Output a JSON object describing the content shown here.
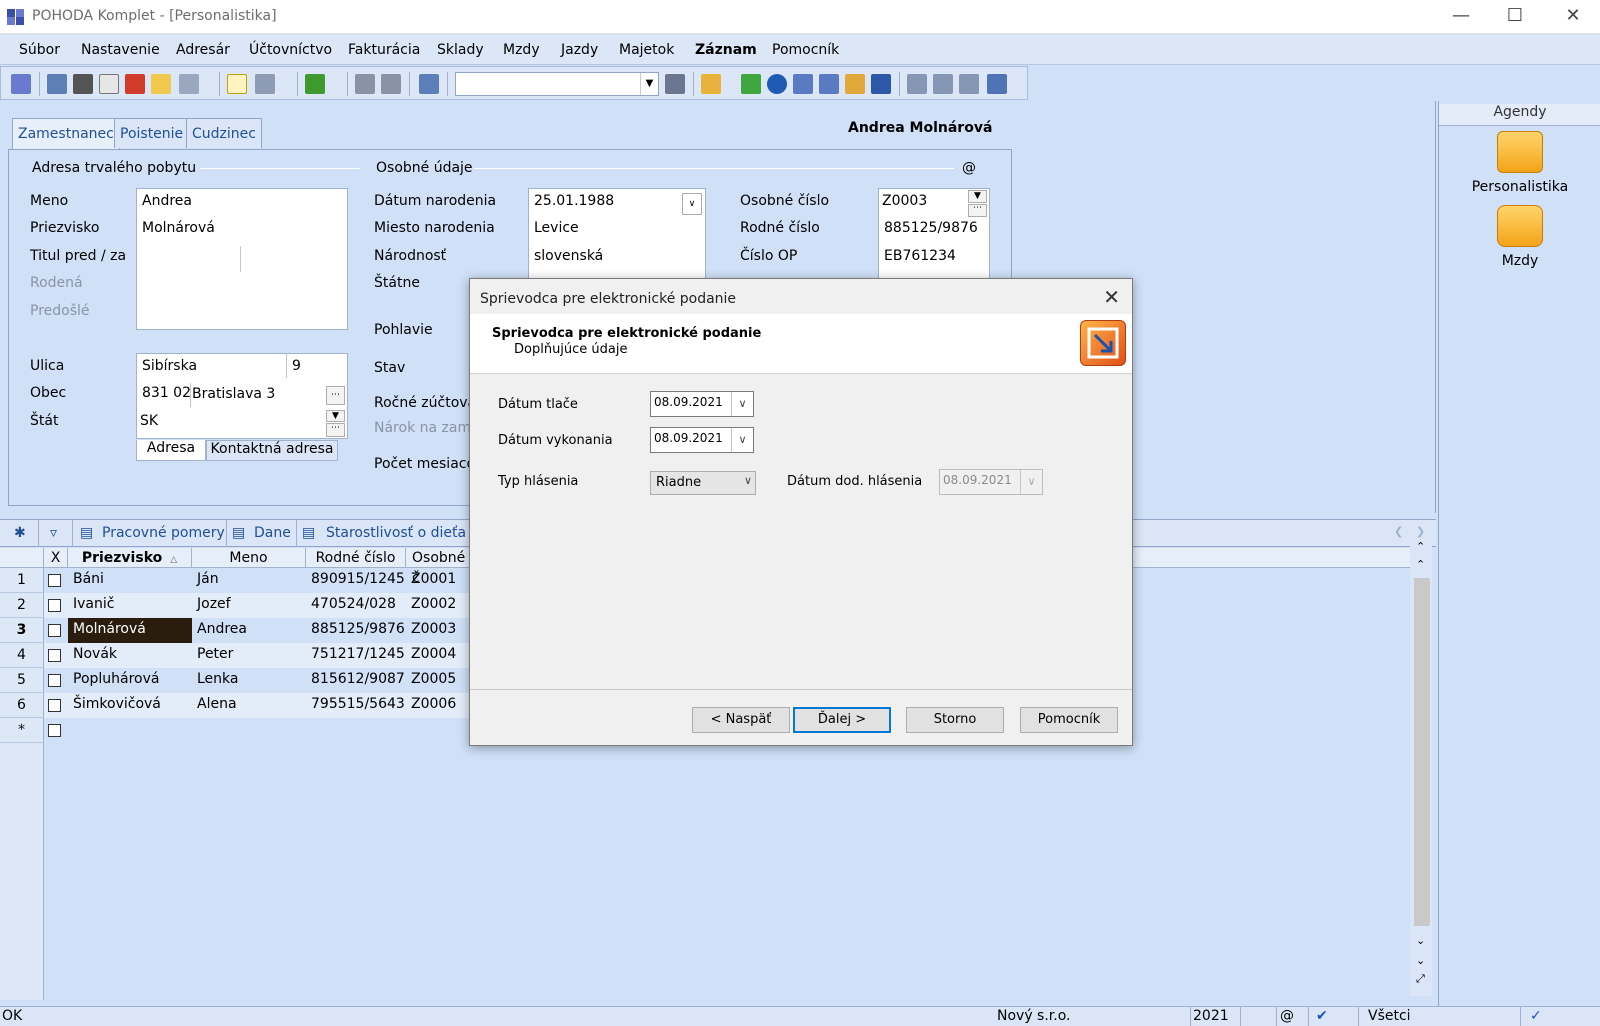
{
  "window": {
    "title": "POHODA Komplet - [Personalistika]"
  },
  "menu": [
    "Súbor",
    "Nastavenie",
    "Adresár",
    "Účtovníctvo",
    "Fakturácia",
    "Sklady",
    "Mzdy",
    "Jazdy",
    "Majetok",
    "Záznam",
    "Pomocník"
  ],
  "record": {
    "heading": "Andrea Molnárová"
  },
  "tabs": [
    "Zamestnanec",
    "Poistenie",
    "Cudzinec"
  ],
  "address": {
    "group_label": "Adresa trvalého pobytu",
    "labels": {
      "meno": "Meno",
      "priezvisko": "Priezvisko",
      "titul": "Titul pred / za",
      "rodena": "Rodená",
      "predosle": "Predošlé",
      "ulica": "Ulica",
      "obec": "Obec",
      "stat": "Štát"
    },
    "meno": "Andrea",
    "priezvisko": "Molnárová",
    "ulica": "Sibírska",
    "cislo": "9",
    "psc": "831 02",
    "obec": "Bratislava 3",
    "stat": "SK",
    "subtabs": [
      "Adresa",
      "Kontaktná adresa"
    ]
  },
  "personal": {
    "group_label": "Osobné údaje",
    "at": "@",
    "labels": {
      "datum": "Dátum narodenia",
      "miesto": "Miesto narodenia",
      "narodnost": "Národnosť",
      "statne": "Štátne",
      "pohlavie": "Pohlavie",
      "stav": "Stav",
      "rocne": "Ročné zúčtova",
      "narok": "Nárok na zame",
      "pocet": "Počet mesiaco",
      "osobne": "Osobné číslo",
      "rodne": "Rodné číslo",
      "op": "Číslo OP"
    },
    "datum_narodenia": "25.01.1988",
    "miesto_narodenia": "Levice",
    "narodnost": "slovenská",
    "osobne_cislo": "Z0003",
    "rodne_cislo": "885125/9876",
    "cislo_op": "EB761234"
  },
  "agendy": {
    "title": "Agendy",
    "items": [
      "Personalistika",
      "Mzdy"
    ]
  },
  "grid_tabs": [
    "Pracovné pomery",
    "Dane",
    "Starostlivosť o dieťa"
  ],
  "grid": {
    "columns": [
      "X",
      "Priezvisko",
      "Meno",
      "Rodné číslo",
      "Osobné č"
    ],
    "rows": [
      {
        "no": "1",
        "priezvisko": "Báni",
        "meno": "Ján",
        "rodne": "890915/1245",
        "osobne": "Z0001"
      },
      {
        "no": "2",
        "priezvisko": "Ivanič",
        "meno": "Jozef",
        "rodne": "470524/028",
        "osobne": "Z0002"
      },
      {
        "no": "3",
        "priezvisko": "Molnárová",
        "meno": "Andrea",
        "rodne": "885125/9876",
        "osobne": "Z0003"
      },
      {
        "no": "4",
        "priezvisko": "Novák",
        "meno": "Peter",
        "rodne": "751217/1245",
        "osobne": "Z0004"
      },
      {
        "no": "5",
        "priezvisko": "Popluhárová",
        "meno": "Lenka",
        "rodne": "815612/9087",
        "osobne": "Z0005"
      },
      {
        "no": "6",
        "priezvisko": "Šimkovičová",
        "meno": "Alena",
        "rodne": "795515/5643",
        "osobne": "Z0006"
      }
    ],
    "new_row": "*",
    "selected_row": "3"
  },
  "status": {
    "left": "OK",
    "company": "Nový s.r.o.",
    "year": "2021",
    "at": "@",
    "filter": "Všetci"
  },
  "dialog": {
    "title": "Sprievodca pre elektronické podanie",
    "header_title": "Sprievodca pre elektronické podanie",
    "header_subtitle": "Doplňujúce údaje",
    "labels": {
      "datum_tlace": "Dátum tlače",
      "datum_vykonania": "Dátum vykonania",
      "typ": "Typ hlásenia",
      "datum_dod": "Dátum dod. hlásenia"
    },
    "datum_tlace": "08.09.2021",
    "datum_vykonania": "08.09.2021",
    "typ_hlasenia": "Riadne",
    "datum_dod": "08.09.2021",
    "buttons": {
      "back": "< Naspäť",
      "next": "Ďalej >",
      "cancel": "Storno",
      "help": "Pomocník"
    }
  },
  "colors": {
    "accent": "#0078d7",
    "selected_row_bg": "#2b1d0e",
    "panel_bg": "#cfe0f7"
  }
}
